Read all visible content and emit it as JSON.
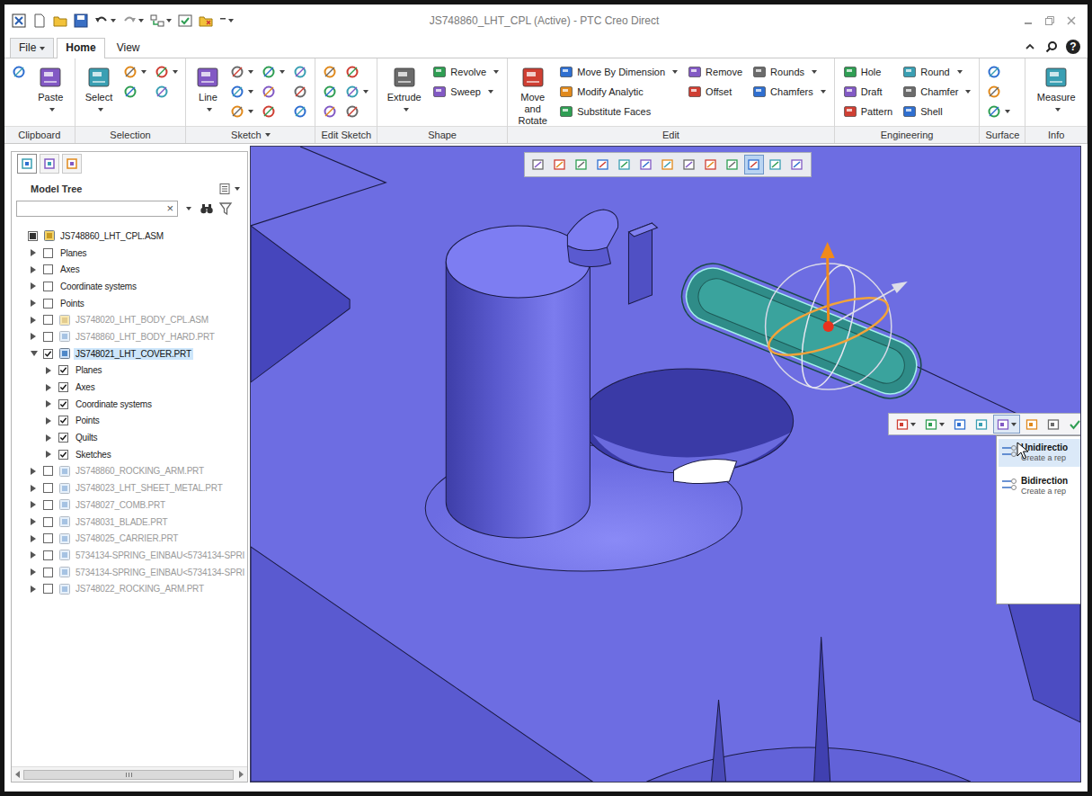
{
  "window": {
    "title": "JS748860_LHT_CPL (Active) - PTC Creo Direct",
    "help": "?"
  },
  "tabs": [
    {
      "label": "File",
      "selected": false,
      "dropdown": true
    },
    {
      "label": "Home",
      "selected": true,
      "dropdown": false
    },
    {
      "label": "View",
      "selected": false,
      "dropdown": false
    }
  ],
  "ribbon": {
    "groups": [
      {
        "label": "Clipboard",
        "dropdown": false,
        "columns": [
          [
            {
              "kind": "icon",
              "dropdown": false
            }
          ],
          [
            {
              "kind": "large",
              "label": "Paste",
              "dropdown": true
            }
          ]
        ]
      },
      {
        "label": "Selection",
        "dropdown": false,
        "columns": [
          [
            {
              "kind": "large",
              "label": "Select",
              "dropdown": true
            }
          ],
          [
            {
              "kind": "icon",
              "dropdown": true
            },
            {
              "kind": "icon",
              "dropdown": false
            }
          ],
          [
            {
              "kind": "icon",
              "dropdown": true
            },
            {
              "kind": "icon",
              "dropdown": false
            }
          ]
        ]
      },
      {
        "label": "Sketch",
        "dropdown": true,
        "columns": [
          [
            {
              "kind": "large",
              "label": "Line",
              "dropdown": true
            }
          ],
          [
            {
              "kind": "icon",
              "dropdown": true
            },
            {
              "kind": "icon",
              "dropdown": true
            },
            {
              "kind": "icon",
              "dropdown": true
            }
          ],
          [
            {
              "kind": "icon",
              "dropdown": true
            },
            {
              "kind": "icon",
              "dropdown": false
            },
            {
              "kind": "icon",
              "dropdown": false
            }
          ],
          [
            {
              "kind": "icon",
              "dropdown": false
            },
            {
              "kind": "icon",
              "dropdown": false
            },
            {
              "kind": "icon",
              "dropdown": false
            }
          ]
        ]
      },
      {
        "label": "Edit Sketch",
        "dropdown": false,
        "columns": [
          [
            {
              "kind": "icon",
              "dropdown": false
            },
            {
              "kind": "icon",
              "dropdown": false
            },
            {
              "kind": "icon",
              "dropdown": false
            }
          ],
          [
            {
              "kind": "icon",
              "dropdown": false
            },
            {
              "kind": "icon",
              "dropdown": true
            },
            {
              "kind": "icon",
              "dropdown": false
            }
          ]
        ]
      },
      {
        "label": "Shape",
        "dropdown": false,
        "columns": [
          [
            {
              "kind": "large",
              "label": "Extrude",
              "dropdown": true
            }
          ],
          [
            {
              "kind": "small",
              "label": "Revolve",
              "dropdown": true
            },
            {
              "kind": "small",
              "label": "Sweep",
              "dropdown": true
            }
          ]
        ]
      },
      {
        "label": "Edit",
        "dropdown": false,
        "columns": [
          [
            {
              "kind": "large",
              "label": "Move and Rotate",
              "dropdown": true
            }
          ],
          [
            {
              "kind": "small",
              "label": "Move By Dimension",
              "dropdown": true
            },
            {
              "kind": "small",
              "label": "Modify Analytic",
              "dropdown": false
            },
            {
              "kind": "small",
              "label": "Substitute Faces",
              "dropdown": false
            }
          ],
          [
            {
              "kind": "small",
              "label": "Remove",
              "dropdown": false
            },
            {
              "kind": "small",
              "label": "Offset",
              "dropdown": false
            }
          ],
          [
            {
              "kind": "small",
              "label": "Rounds",
              "dropdown": true
            },
            {
              "kind": "small",
              "label": "Chamfers",
              "dropdown": true
            }
          ]
        ]
      },
      {
        "label": "Engineering",
        "dropdown": false,
        "columns": [
          [
            {
              "kind": "small",
              "label": "Hole",
              "dropdown": false
            },
            {
              "kind": "small",
              "label": "Draft",
              "dropdown": false
            },
            {
              "kind": "small",
              "label": "Pattern",
              "dropdown": false
            }
          ],
          [
            {
              "kind": "small",
              "label": "Round",
              "dropdown": true
            },
            {
              "kind": "small",
              "label": "Chamfer",
              "dropdown": true
            },
            {
              "kind": "small",
              "label": "Shell",
              "dropdown": false
            }
          ]
        ]
      },
      {
        "label": "Surface",
        "dropdown": false,
        "columns": [
          [
            {
              "kind": "icon",
              "dropdown": false
            },
            {
              "kind": "icon",
              "dropdown": false
            },
            {
              "kind": "icon",
              "dropdown": true
            }
          ]
        ]
      },
      {
        "label": "Info",
        "dropdown": false,
        "columns": [
          [
            {
              "kind": "large",
              "label": "Measure",
              "dropdown": true
            }
          ]
        ]
      }
    ]
  },
  "modelTree": {
    "title": "Model Tree",
    "clear": "×",
    "panelTabs": [
      {
        "selected": true
      },
      {
        "selected": false
      },
      {
        "selected": false
      }
    ],
    "items": [
      {
        "label": "JS748860_LHT_CPL.ASM",
        "level": 0,
        "kind": "assembly",
        "expandable": false,
        "expanded": false,
        "checked": false,
        "mixed": true,
        "dimmed": false,
        "selected": false
      },
      {
        "label": "Planes",
        "level": 1,
        "kind": "folder",
        "expandable": true,
        "expanded": false,
        "checked": false,
        "mixed": false,
        "dimmed": false,
        "selected": false
      },
      {
        "label": "Axes",
        "level": 1,
        "kind": "folder",
        "expandable": true,
        "expanded": false,
        "checked": false,
        "mixed": false,
        "dimmed": false,
        "selected": false
      },
      {
        "label": "Coordinate systems",
        "level": 1,
        "kind": "folder",
        "expandable": true,
        "expanded": false,
        "checked": false,
        "mixed": false,
        "dimmed": false,
        "selected": false
      },
      {
        "label": "Points",
        "level": 1,
        "kind": "folder",
        "expandable": true,
        "expanded": false,
        "checked": false,
        "mixed": false,
        "dimmed": false,
        "selected": false
      },
      {
        "label": "JS748020_LHT_BODY_CPL.ASM",
        "level": 1,
        "kind": "assembly",
        "expandable": true,
        "expanded": false,
        "checked": false,
        "mixed": false,
        "dimmed": true,
        "selected": false
      },
      {
        "label": "JS748860_LHT_BODY_HARD.PRT",
        "level": 1,
        "kind": "part",
        "expandable": true,
        "expanded": false,
        "checked": false,
        "mixed": false,
        "dimmed": true,
        "selected": false
      },
      {
        "label": "JS748021_LHT_COVER.PRT",
        "level": 1,
        "kind": "part",
        "expandable": true,
        "expanded": true,
        "checked": true,
        "mixed": false,
        "dimmed": false,
        "selected": true
      },
      {
        "label": "Planes",
        "level": 2,
        "kind": "folder",
        "expandable": true,
        "expanded": false,
        "checked": true,
        "mixed": false,
        "dimmed": false,
        "selected": false
      },
      {
        "label": "Axes",
        "level": 2,
        "kind": "folder",
        "expandable": true,
        "expanded": false,
        "checked": true,
        "mixed": false,
        "dimmed": false,
        "selected": false
      },
      {
        "label": "Coordinate systems",
        "level": 2,
        "kind": "folder",
        "expandable": true,
        "expanded": false,
        "checked": true,
        "mixed": false,
        "dimmed": false,
        "selected": false
      },
      {
        "label": "Points",
        "level": 2,
        "kind": "folder",
        "expandable": true,
        "expanded": false,
        "checked": true,
        "mixed": false,
        "dimmed": false,
        "selected": false
      },
      {
        "label": "Quilts",
        "level": 2,
        "kind": "folder",
        "expandable": true,
        "expanded": false,
        "checked": true,
        "mixed": false,
        "dimmed": false,
        "selected": false
      },
      {
        "label": "Sketches",
        "level": 2,
        "kind": "folder",
        "expandable": true,
        "expanded": false,
        "checked": true,
        "mixed": false,
        "dimmed": false,
        "selected": false
      },
      {
        "label": "JS748860_ROCKING_ARM.PRT",
        "level": 1,
        "kind": "part",
        "expandable": true,
        "expanded": false,
        "checked": false,
        "mixed": false,
        "dimmed": true,
        "selected": false
      },
      {
        "label": "JS748023_LHT_SHEET_METAL.PRT",
        "level": 1,
        "kind": "part",
        "expandable": true,
        "expanded": false,
        "checked": false,
        "mixed": false,
        "dimmed": true,
        "selected": false
      },
      {
        "label": "JS748027_COMB.PRT",
        "level": 1,
        "kind": "part",
        "expandable": true,
        "expanded": false,
        "checked": false,
        "mixed": false,
        "dimmed": true,
        "selected": false
      },
      {
        "label": "JS748031_BLADE.PRT",
        "level": 1,
        "kind": "part",
        "expandable": true,
        "expanded": false,
        "checked": false,
        "mixed": false,
        "dimmed": true,
        "selected": false
      },
      {
        "label": "JS748025_CARRIER.PRT",
        "level": 1,
        "kind": "part",
        "expandable": true,
        "expanded": false,
        "checked": false,
        "mixed": false,
        "dimmed": true,
        "selected": false
      },
      {
        "label": "5734134-SPRING_EINBAU<5734134-SPRI",
        "level": 1,
        "kind": "part",
        "expandable": true,
        "expanded": false,
        "checked": false,
        "mixed": false,
        "dimmed": true,
        "selected": false
      },
      {
        "label": "5734134-SPRING_EINBAU<5734134-SPRI",
        "level": 1,
        "kind": "part",
        "expandable": true,
        "expanded": false,
        "checked": false,
        "mixed": false,
        "dimmed": true,
        "selected": false
      },
      {
        "label": "JS748022_ROCKING_ARM.PRT",
        "level": 1,
        "kind": "part",
        "expandable": true,
        "expanded": false,
        "checked": false,
        "mixed": false,
        "dimmed": true,
        "selected": false
      }
    ]
  },
  "viewport": {
    "toolbar": {
      "buttons": [
        {
          "selected": false
        },
        {
          "selected": false
        },
        {
          "selected": false
        },
        {
          "selected": false
        },
        {
          "selected": false
        },
        {
          "selected": false
        },
        {
          "selected": false
        },
        {
          "selected": false
        },
        {
          "selected": false
        },
        {
          "selected": false
        },
        {
          "selected": true
        },
        {
          "selected": false
        },
        {
          "selected": false
        }
      ]
    },
    "feature": {
      "selected": true
    },
    "miniToolbar": {
      "buttons": [
        {
          "dropdown": true,
          "selected": false
        },
        {
          "dropdown": true,
          "selected": false
        },
        {
          "dropdown": false,
          "selected": false
        },
        {
          "dropdown": false,
          "selected": false
        },
        {
          "dropdown": true,
          "selected": true
        },
        {
          "dropdown": false,
          "selected": false
        },
        {
          "dropdown": false,
          "selected": false
        },
        {
          "dropdown": false,
          "selected": false
        }
      ]
    },
    "menu": {
      "items": [
        {
          "title": "Unidirectio",
          "description": "Create a rep",
          "selected": true
        },
        {
          "title": "Bidirection",
          "description": "Create a rep",
          "selected": false
        }
      ]
    }
  }
}
